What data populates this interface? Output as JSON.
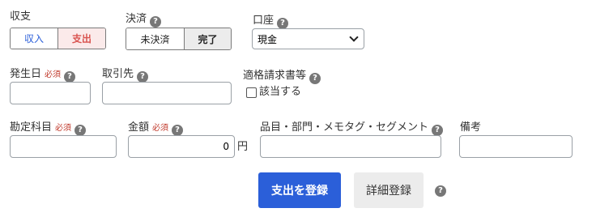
{
  "type_section": {
    "label": "収支",
    "options": [
      {
        "label": "収入",
        "selected": false,
        "color": "#2b5fd9"
      },
      {
        "label": "支出",
        "selected": true,
        "color": "#d9534f"
      }
    ]
  },
  "settlement": {
    "label": "決済",
    "help": "?",
    "options": [
      {
        "label": "未決済",
        "selected": false
      },
      {
        "label": "完了",
        "selected": true
      }
    ]
  },
  "account": {
    "label": "口座",
    "help": "?",
    "value": "現金"
  },
  "date": {
    "label": "発生日",
    "required": "必須",
    "help": "?",
    "value": ""
  },
  "partner": {
    "label": "取引先",
    "help": "?",
    "value": ""
  },
  "invoice": {
    "label": "適格請求書等",
    "help": "?",
    "checkbox_label": "該当する",
    "checked": false
  },
  "category": {
    "label": "勘定科目",
    "required": "必須",
    "help": "?",
    "value": ""
  },
  "amount": {
    "label": "金額",
    "required": "必須",
    "help": "?",
    "value": "0",
    "unit": "円"
  },
  "item_tags": {
    "label": "品目・部門・メモタグ・セグメント",
    "help": "?",
    "value": ""
  },
  "memo": {
    "label": "備考",
    "value": ""
  },
  "actions": {
    "submit_label": "支出を登録",
    "detail_label": "詳細登録",
    "help": "?"
  },
  "colors": {
    "primary": "#2b5fd9",
    "expense_red": "#d9534f",
    "required_red": "#c0392b",
    "help_gray": "#777777"
  }
}
